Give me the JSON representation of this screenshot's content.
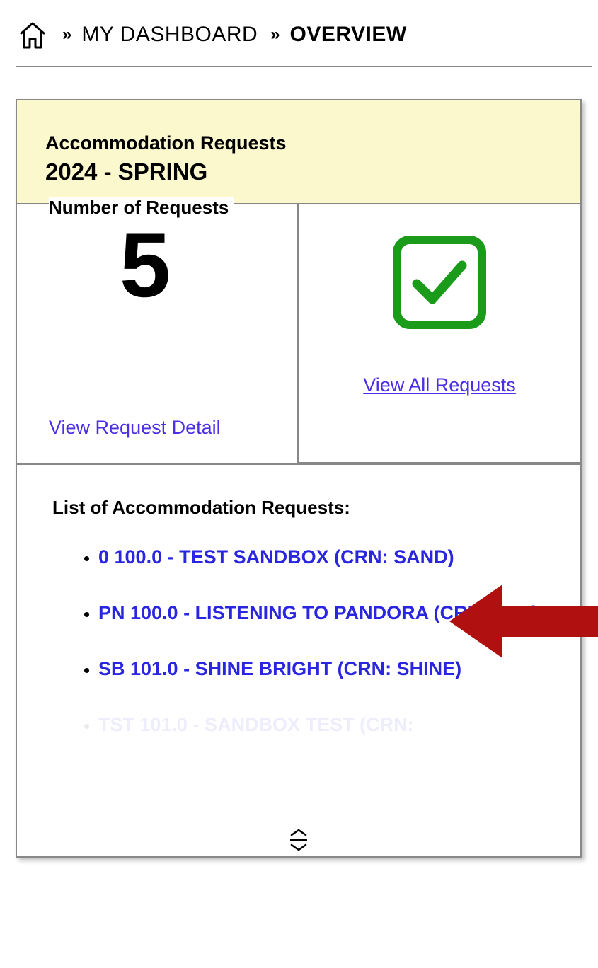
{
  "breadcrumb": {
    "dashboard": "MY DASHBOARD",
    "overview": "OVERVIEW"
  },
  "card": {
    "title": "Accommodation Requests",
    "term": "2024 - SPRING",
    "requests_label": "Number of Requests",
    "requests_count": "5",
    "view_detail": "View Request Detail",
    "view_all": "View All Requests",
    "list_heading": "List of Accommodation Requests:",
    "items": [
      "0 100.0 - TEST SANDBOX (CRN: SAND)",
      "PN 100.0 - LISTENING TO PANDORA (CRN: PAN)",
      "SB 101.0 - SHINE BRIGHT (CRN: SHINE)",
      "TST 101.0 - SANDBOX TEST (CRN:"
    ]
  },
  "colors": {
    "link": "#4a2fe6",
    "green": "#1a9b1a",
    "arrow": "#b11010",
    "header_bg": "#fbf8ce"
  }
}
